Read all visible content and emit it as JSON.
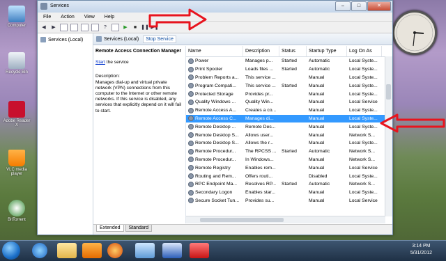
{
  "desktop": {
    "icons": [
      {
        "label": "Computer"
      },
      {
        "label": "Recycle Bin"
      },
      {
        "label": "Adobe Reader X"
      },
      {
        "label": "VLC media player"
      },
      {
        "label": "BitTorrent"
      }
    ]
  },
  "window": {
    "title": "Services",
    "menu": [
      "File",
      "Action",
      "View",
      "Help"
    ],
    "left_pane_item": "Services (Local)",
    "right_header_label": "Services (Local)",
    "stop_service_link": "Stop Service",
    "description": {
      "service_name": "Remote Access Connection Manager",
      "start_link": "Start",
      "start_suffix": " the service",
      "label": "Description:",
      "text": "Manages dial-up and virtual private network (VPN) connections from this computer to the Internet or other remote networks. If this service is disabled, any services that explicitly depend on it will fail to start."
    },
    "columns": [
      "Name",
      "Description",
      "Status",
      "Startup Type",
      "Log On As"
    ],
    "rows": [
      {
        "name": "Power",
        "desc": "Manages p...",
        "status": "Started",
        "startup": "Automatic",
        "logon": "Local Syste..."
      },
      {
        "name": "Print Spooler",
        "desc": "Loads files ...",
        "status": "Started",
        "startup": "Automatic",
        "logon": "Local Syste..."
      },
      {
        "name": "Problem Reports a...",
        "desc": "This service ...",
        "status": "",
        "startup": "Manual",
        "logon": "Local Syste..."
      },
      {
        "name": "Program Compati...",
        "desc": "This service ...",
        "status": "Started",
        "startup": "Manual",
        "logon": "Local Syste..."
      },
      {
        "name": "Protected Storage",
        "desc": "Provides pr...",
        "status": "",
        "startup": "Manual",
        "logon": "Local Syste..."
      },
      {
        "name": "Quality Windows ...",
        "desc": "Quality Win...",
        "status": "",
        "startup": "Manual",
        "logon": "Local Service"
      },
      {
        "name": "Remote Access A...",
        "desc": "Creates a co...",
        "status": "",
        "startup": "Manual",
        "logon": "Local Syste..."
      },
      {
        "name": "Remote Access C...",
        "desc": "Manages di...",
        "status": "",
        "startup": "Manual",
        "logon": "Local Syste...",
        "selected": true
      },
      {
        "name": "Remote Desktop ...",
        "desc": "Remote Des...",
        "status": "",
        "startup": "Manual",
        "logon": "Local Syste..."
      },
      {
        "name": "Remote Desktop S...",
        "desc": "Allows user...",
        "status": "",
        "startup": "Manual",
        "logon": "Network S..."
      },
      {
        "name": "Remote Desktop S...",
        "desc": "Allows the r...",
        "status": "",
        "startup": "Manual",
        "logon": "Local Syste..."
      },
      {
        "name": "Remote Procedur...",
        "desc": "The RPCSS ...",
        "status": "Started",
        "startup": "Automatic",
        "logon": "Network S..."
      },
      {
        "name": "Remote Procedur...",
        "desc": "In Windows...",
        "status": "",
        "startup": "Manual",
        "logon": "Network S..."
      },
      {
        "name": "Remote Registry",
        "desc": "Enables rem...",
        "status": "",
        "startup": "Manual",
        "logon": "Local Service"
      },
      {
        "name": "Routing and Rem...",
        "desc": "Offers routi...",
        "status": "",
        "startup": "Disabled",
        "logon": "Local Syste..."
      },
      {
        "name": "RPC Endpoint Ma...",
        "desc": "Resolves RP...",
        "status": "Started",
        "startup": "Automatic",
        "logon": "Network S..."
      },
      {
        "name": "Secondary Logon",
        "desc": "Enables star...",
        "status": "",
        "startup": "Manual",
        "logon": "Local Syste..."
      },
      {
        "name": "Secure Socket Tun...",
        "desc": "Provides su...",
        "status": "",
        "startup": "Manual",
        "logon": "Local Service"
      }
    ],
    "tabs": [
      "Extended",
      "Standard"
    ]
  },
  "taskbar": {
    "time": "3:14 PM",
    "date": "5/31/2012"
  },
  "colors": {
    "selection": "#3399ff",
    "annotation_arrow": "#e8141e"
  }
}
